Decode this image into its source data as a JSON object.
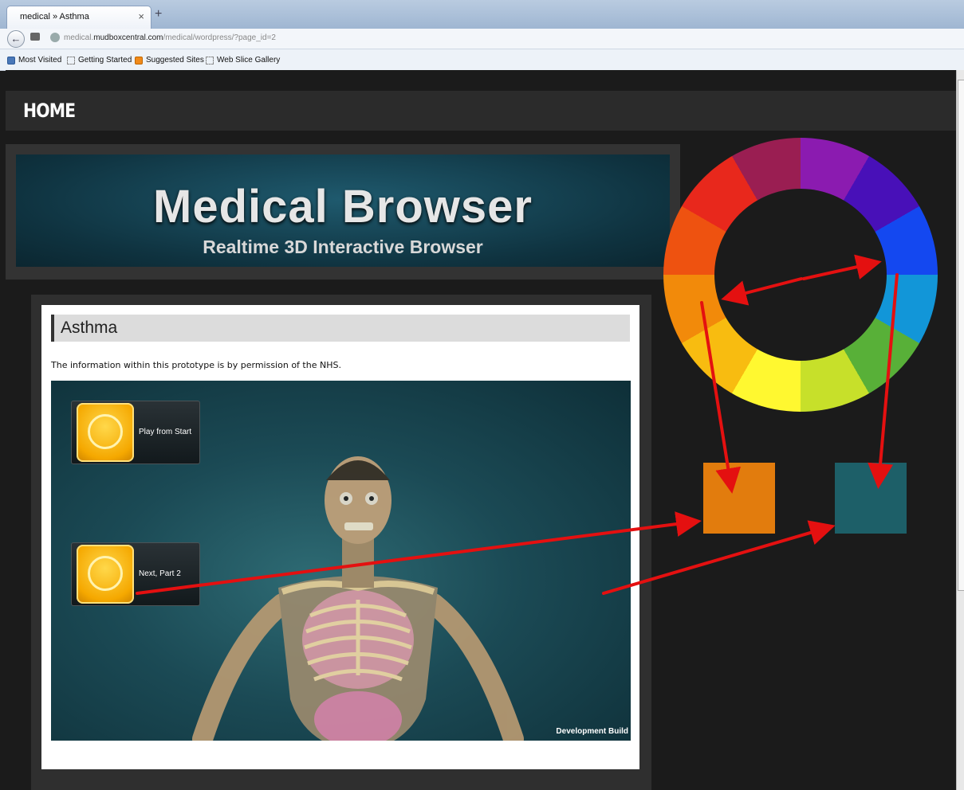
{
  "browser": {
    "tab_title": "medical » Asthma",
    "tab_close": "×",
    "new_tab": "+",
    "back": "←",
    "url_prefix": "medical.",
    "url_domain": "mudboxcentral.com",
    "url_path": "/medical/wordpress/?page_id=2"
  },
  "bookmarks": [
    {
      "label": "Most Visited",
      "icon": "bookmark-folder-icon"
    },
    {
      "label": "Getting Started",
      "icon": "page-icon"
    },
    {
      "label": "Suggested Sites",
      "icon": "suggested-sites-icon"
    },
    {
      "label": "Web Slice Gallery",
      "icon": "page-icon"
    }
  ],
  "nav": {
    "home": "HOME"
  },
  "banner": {
    "title": "Medical Browser",
    "subtitle": "Realtime 3D Interactive Browser"
  },
  "article": {
    "title": "Asthma",
    "intro": "The information within this prototype is by permission of the NHS."
  },
  "viewer": {
    "btn_play_start": "Play from Start",
    "btn_next": "Next, Part 2",
    "footer": "Development Build"
  },
  "annotation": {
    "swatch_orange": "#e27c0d",
    "swatch_teal": "#1d5f68",
    "arrow_color": "#e41010"
  }
}
